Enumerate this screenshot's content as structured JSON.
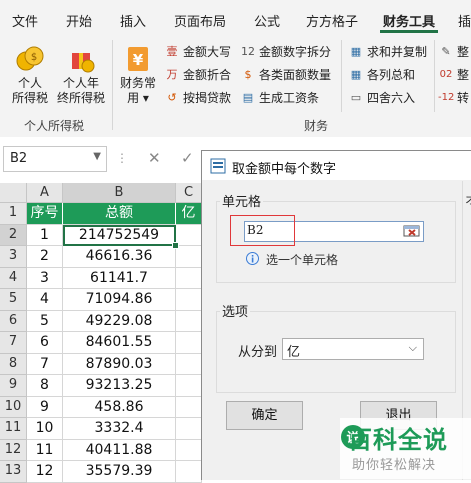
{
  "ribbon": {
    "tabs": [
      "文件",
      "开始",
      "插入",
      "页面布局",
      "公式",
      "方方格子",
      "财务工具",
      "插"
    ],
    "active_tab": "财务工具",
    "big_buttons": [
      {
        "label": "个人\n所得税"
      },
      {
        "label": "个人年\n终所得税"
      },
      {
        "label": "财务常\n用 ▾"
      }
    ],
    "small_buttons": [
      {
        "label": "金额大写",
        "icon": "壹"
      },
      {
        "label": "金额折合",
        "icon": "万"
      },
      {
        "label": "按揭贷款",
        "icon": "↺"
      },
      {
        "label": "金额数字拆分",
        "icon": "12"
      },
      {
        "label": "各类面额数量",
        "icon": "$"
      },
      {
        "label": "生成工资条",
        "icon": "▤"
      },
      {
        "label": "求和并复制",
        "icon": "▦"
      },
      {
        "label": "各列总和",
        "icon": "▦"
      },
      {
        "label": "四舍六入",
        "icon": "▭"
      },
      {
        "label": "整",
        "icon": "✎"
      },
      {
        "label": "整",
        "icon": "02"
      },
      {
        "label": "转",
        "icon": "-12"
      }
    ],
    "groups": [
      "个人所得税",
      "财务"
    ]
  },
  "formula_bar": {
    "name_box": "B2",
    "fx": "fx"
  },
  "sheet": {
    "columns": [
      "A",
      "B",
      "C"
    ],
    "header_row": [
      "序号",
      "总额",
      "亿"
    ],
    "row_numbers": [
      "1",
      "2",
      "3",
      "4",
      "5",
      "6",
      "7",
      "8",
      "9",
      "10",
      "11",
      "12",
      "13"
    ],
    "rows": [
      [
        "1",
        "214752549"
      ],
      [
        "2",
        "46616.36"
      ],
      [
        "3",
        "61141.7"
      ],
      [
        "4",
        "71094.86"
      ],
      [
        "5",
        "49229.08"
      ],
      [
        "6",
        "84601.55"
      ],
      [
        "7",
        "87890.03"
      ],
      [
        "8",
        "93213.25"
      ],
      [
        "9",
        "458.86"
      ],
      [
        "10",
        "3332.4"
      ],
      [
        "11",
        "40411.88"
      ],
      [
        "12",
        "35579.39"
      ]
    ],
    "header_color": "#1e9b58"
  },
  "dialog": {
    "title": "取金额中每个数字",
    "cell_section": "单元格",
    "cell_value": "B2",
    "hint": "选一个单元格",
    "options_section": "选项",
    "split_label": "从分到",
    "split_value": "亿",
    "ok_label": "确定",
    "exit_label": "退出",
    "right_section_partial": "オ"
  },
  "watermark": {
    "title": "百科全说",
    "subtitle": "助你轻松解决"
  }
}
